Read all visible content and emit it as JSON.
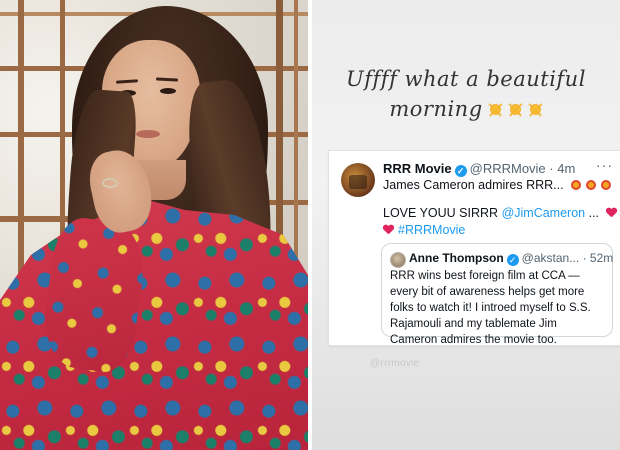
{
  "story": {
    "caption_line1": "Uffff what a beautiful",
    "caption_line2": "morning",
    "sun_icons": [
      "sun-icon",
      "sun-icon",
      "sun-icon"
    ],
    "watermark": "@rrrmovie"
  },
  "tweet": {
    "author_name": "RRR Movie",
    "author_handle": "@RRRMovie",
    "separator": "·",
    "time": "4m",
    "more_label": "···",
    "line1": "James Cameron admires RRR...",
    "line2_text": "LOVE YOUU SIRRR",
    "line2_mention": "@JimCameron",
    "line2_ellipsis": "...",
    "hashtag": "#RRRMovie",
    "colors": {
      "link": "#1d9bf0",
      "heart": "#e0245e",
      "verified": "#1d9bf0"
    }
  },
  "quote": {
    "author_name": "Anne Thompson",
    "author_handle": "@akstan...",
    "separator": "·",
    "time": "52m",
    "body": "RRR wins best foreign film at CCA — every bit of awareness helps get more folks to watch it! I introed myself to S.S. Rajamouli and my tablemate Jim Cameron admires the movie too."
  }
}
